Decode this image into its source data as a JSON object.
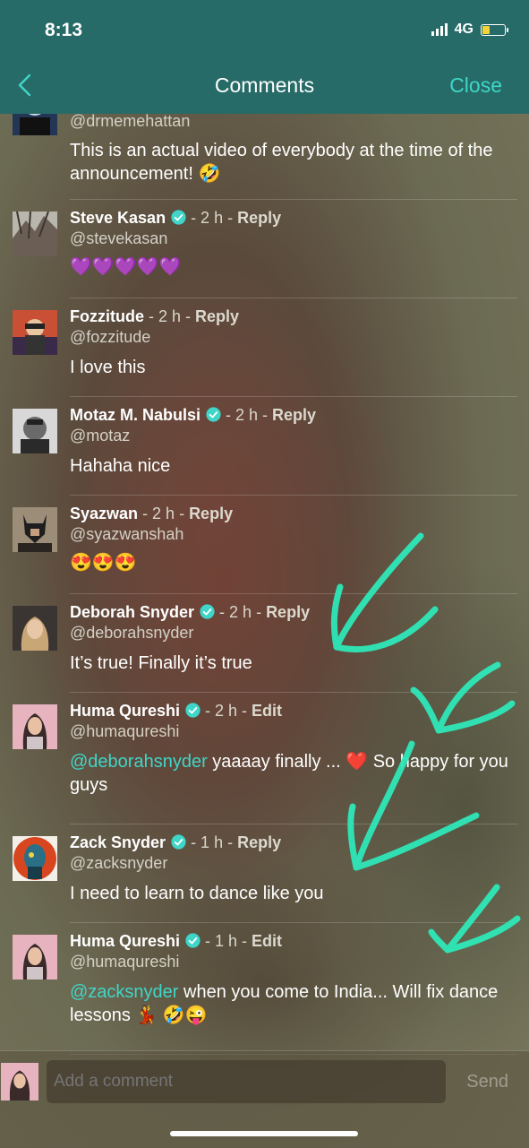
{
  "status_bar": {
    "time": "8:13",
    "network": "4G"
  },
  "header": {
    "title": "Comments",
    "close_label": "Close"
  },
  "comments": [
    {
      "name": "",
      "handle": "@drmemehattan",
      "text": "This is an actual video of everybody at the time of the announcement! 🤣"
    },
    {
      "name": "Steve Kasan",
      "verified": true,
      "time": " - 2 h - ",
      "action": "Reply",
      "handle": "@stevekasan",
      "text": "💜💜💜💜💜"
    },
    {
      "name": "Fozzitude",
      "time": " - 2 h - ",
      "action": "Reply",
      "handle": "@fozzitude",
      "text": "I love this"
    },
    {
      "name": "Motaz M. Nabulsi",
      "verified": true,
      "time": " - 2 h - ",
      "action": "Reply",
      "handle": "@motaz",
      "text": "Hahaha nice"
    },
    {
      "name": "Syazwan",
      "time": " - 2 h - ",
      "action": "Reply",
      "handle": "@syazwanshah",
      "text": "😍😍😍"
    },
    {
      "name": "Deborah Snyder",
      "verified": true,
      "time": " - 2 h - ",
      "action": "Reply",
      "handle": "@deborahsnyder",
      "text": "It’s true!  Finally it’s true"
    },
    {
      "name": "Huma Qureshi",
      "verified": true,
      "time": " - 2 h - ",
      "action": "Edit",
      "handle": "@humaqureshi",
      "mention": "@deborahsnyder",
      "text": " yaaaay finally ... ❤️ So happy for you guys"
    },
    {
      "name": "Zack Snyder",
      "verified": true,
      "time": " - 1 h - ",
      "action": "Reply",
      "handle": "@zacksnyder",
      "text": "I need to learn to dance like you"
    },
    {
      "name": "Huma Qureshi",
      "verified": true,
      "time": " - 1 h - ",
      "action": "Edit",
      "handle": "@humaqureshi",
      "mention": "@zacksnyder",
      "text": " when you come to India... Will fix dance lessons 💃 🤣😜"
    }
  ],
  "composer": {
    "placeholder": "Add a comment",
    "send_label": "Send"
  },
  "colors": {
    "header": "#266b67",
    "accent": "#3fd6c9",
    "battery": "#f4d33a",
    "annotation": "#2ee8b8"
  },
  "icons": [
    "back-chevron-icon",
    "verified-badge-icon",
    "signal-icon",
    "battery-icon"
  ]
}
